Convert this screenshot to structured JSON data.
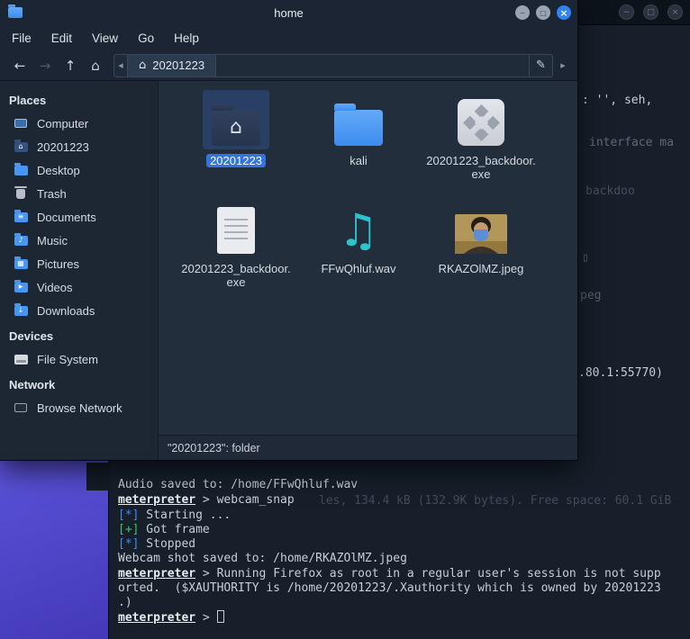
{
  "glyphs": {
    "minimize": "−",
    "maximize": "□",
    "close": "×",
    "back": "←",
    "forward": "→",
    "up": "↑",
    "home": "⌂",
    "crumb_home": "⌂",
    "edit_path": "✎",
    "scroll_left": "◀",
    "scroll_right": "▶",
    "audio_note": "♫",
    "home_folder": "⌂"
  },
  "colors": {
    "accent_blue": "#2f82f7",
    "selection_blue": "#3374e4",
    "folder_blue": "#4796f2",
    "audio_teal": "#2cc3cd",
    "status_green": "#45c06f",
    "status_info_blue": "#3f8cf7",
    "wallpaper_purple": "#4f47cd"
  },
  "file_manager": {
    "title": "home",
    "menu": [
      {
        "label": "File"
      },
      {
        "label": "Edit"
      },
      {
        "label": "View"
      },
      {
        "label": "Go"
      },
      {
        "label": "Help"
      }
    ],
    "path_segment": "20201223",
    "sidebar": {
      "sections": [
        {
          "header": "Places",
          "items": [
            {
              "label": "Computer"
            },
            {
              "label": "20201223"
            },
            {
              "label": "Desktop"
            },
            {
              "label": "Trash"
            },
            {
              "label": "Documents"
            },
            {
              "label": "Music"
            },
            {
              "label": "Pictures"
            },
            {
              "label": "Videos"
            },
            {
              "label": "Downloads"
            }
          ]
        },
        {
          "header": "Devices",
          "items": [
            {
              "label": "File System"
            }
          ]
        },
        {
          "header": "Network",
          "items": [
            {
              "label": "Browse Network"
            }
          ]
        }
      ]
    },
    "files": [
      {
        "label": "20201223",
        "type": "home-folder",
        "selected": true
      },
      {
        "label": "kali",
        "type": "folder"
      },
      {
        "label": "20201223_backdoor.exe",
        "type": "executable"
      },
      {
        "label": "20201223_backdoor.exe",
        "type": "document"
      },
      {
        "label": "FFwQhluf.wav",
        "type": "audio"
      },
      {
        "label": "RKAZOlMZ.jpeg",
        "type": "image"
      }
    ],
    "status": "\"20201223\": folder"
  },
  "terminal": {
    "prompt": "meterpreter",
    "separator": " > ",
    "audio_saved_line": "Audio saved to: /home/FFwQhluf.wav",
    "webcam_command": "webcam_snap",
    "ghost_status": "les, 134.4 kB (132.9K bytes). Free space: 60.1 GiB",
    "starting_tag": "[*]",
    "starting_text": " Starting ...",
    "frame_tag": "[+]",
    "frame_text": " Got frame",
    "stopped_tag": "[*]",
    "stopped_text": " Stopped",
    "webcam_saved_line": "Webcam shot saved to: /home/RKAZOlMZ.jpeg",
    "firefox_line1": "Running Firefox as root in a regular user's session is not supp",
    "firefox_line2": "orted.  ($XAUTHORITY is /home/20201223/.Xauthority which is owned by 20201223",
    "firefox_line3": ".)",
    "fragments": [
      {
        "text": ": '', seh,"
      },
      {
        "text": "interface ma"
      },
      {
        "text": "backdoo"
      },
      {
        "text": "▯"
      },
      {
        "text": "peg"
      },
      {
        "text": ".80.1:55770)"
      }
    ]
  }
}
